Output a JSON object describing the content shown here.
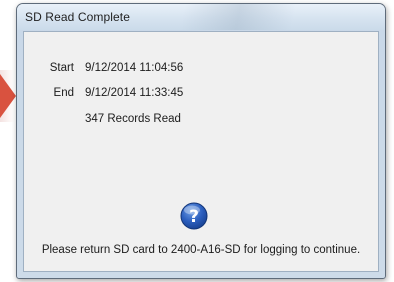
{
  "dialog": {
    "title": "SD Read Complete",
    "start_label": "Start",
    "start_value": "9/12/2014 11:04:56",
    "end_label": "End",
    "end_value": "9/12/2014 11:33:45",
    "records": "347 Records Read",
    "icon": "question-icon",
    "message": "Please return SD card to 2400-A16-SD for logging to continue."
  },
  "colors": {
    "icon_blue": "#1e4fa8",
    "arrow_red": "#d9523f"
  }
}
